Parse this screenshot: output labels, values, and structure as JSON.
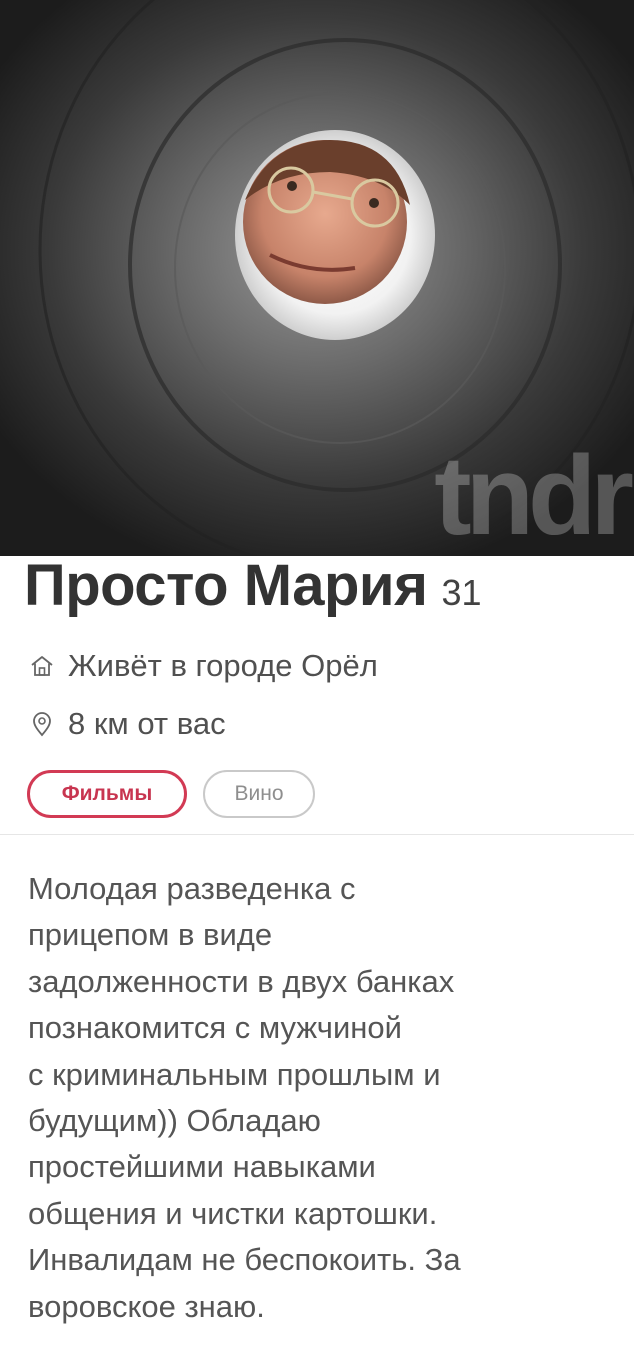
{
  "photo": {
    "watermark": "tndr",
    "description_icon": "profile-photo"
  },
  "profile": {
    "name": "Просто Мария",
    "age": "31",
    "city": "Живёт в городе Орёл",
    "distance": "8 км от вас",
    "city_icon": "home-icon",
    "distance_icon": "location-pin-icon"
  },
  "interests": [
    {
      "label": "Фильмы",
      "state": "shared"
    },
    {
      "label": "Вино",
      "state": "not-shared"
    }
  ],
  "bio": {
    "lines": [
      "Молодая разведенка с",
      "прицепом в виде",
      "задолженности в двух банках",
      "познакомится с мужчиной",
      "с криминальным прошлым и",
      "будущим))   Обладаю",
      "простейшими навыками",
      "общения и чистки картошки.",
      "Инвалидам не беспокоить. За",
      "воровское знаю."
    ]
  },
  "colors": {
    "accent": "#d23a54",
    "text_dark": "#333333",
    "text_secondary": "#555555"
  }
}
